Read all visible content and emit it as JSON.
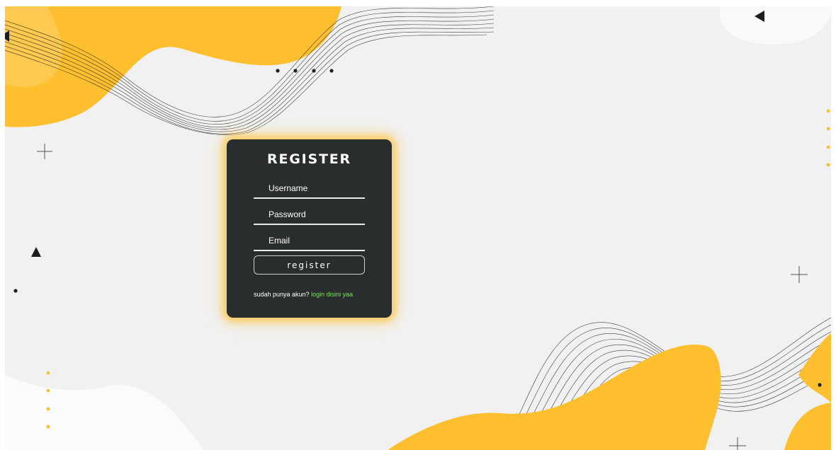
{
  "form": {
    "title": "REGISTER",
    "username_placeholder": "Username",
    "password_placeholder": "Password",
    "email_placeholder": "Email",
    "submit_label": "register",
    "account_prompt": "sudah punya akun?",
    "login_link": "login disini yaa"
  },
  "colors": {
    "background": "#f1f1f1",
    "card": "#2a2d2d",
    "accent_yellow": "#ffbf2f",
    "glow": "#ffb814",
    "link_green": "#7ee35a",
    "text": "#ffffff",
    "decoration_dark": "#222222"
  },
  "icons": {
    "shapes": [
      "dot-row-icon",
      "plus-icon",
      "triangle-icon",
      "dot-icon",
      "yellow-dot-column-icon"
    ]
  }
}
